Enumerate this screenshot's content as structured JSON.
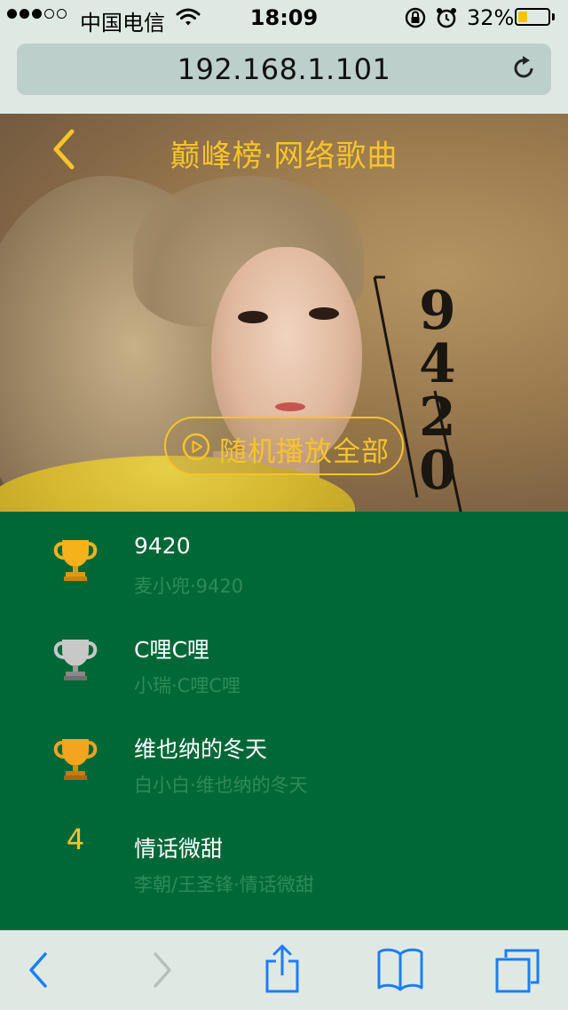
{
  "status_bar": {
    "carrier": "中国电信",
    "time": "18:09",
    "battery_percent": "32%",
    "battery_level": 0.32,
    "signal_bars_filled": 3,
    "signal_bars_total": 5,
    "battery_color": "#f6c500"
  },
  "address_bar": {
    "url": "192.168.1.101"
  },
  "header": {
    "title": "巅峰榜·网络歌曲",
    "shuffle_label": "随机播放全部",
    "accent_color": "#f5c42c",
    "cover_text": "9420"
  },
  "songs": [
    {
      "rank": "1",
      "icon": "gold-trophy-icon",
      "title": "9420",
      "subtitle": "麦小兜·9420"
    },
    {
      "rank": "2",
      "icon": "silver-trophy-icon",
      "title": "C哩C哩",
      "subtitle": "小瑞·C哩C哩"
    },
    {
      "rank": "3",
      "icon": "bronze-trophy-icon",
      "title": "维也纳的冬天",
      "subtitle": "白小白·维也纳的冬天"
    },
    {
      "rank": "4",
      "icon": "",
      "title": "情话微甜",
      "subtitle": "李朝/王圣锋·情话微甜"
    }
  ],
  "toolbar": {
    "icons": [
      "back-arrow-icon",
      "forward-arrow-icon",
      "share-icon",
      "bookmarks-icon",
      "tabs-icon"
    ]
  },
  "colors": {
    "list_background": "#006837",
    "subtitle_color": "#2e8a57",
    "ios_blue": "#1b7ef5"
  }
}
